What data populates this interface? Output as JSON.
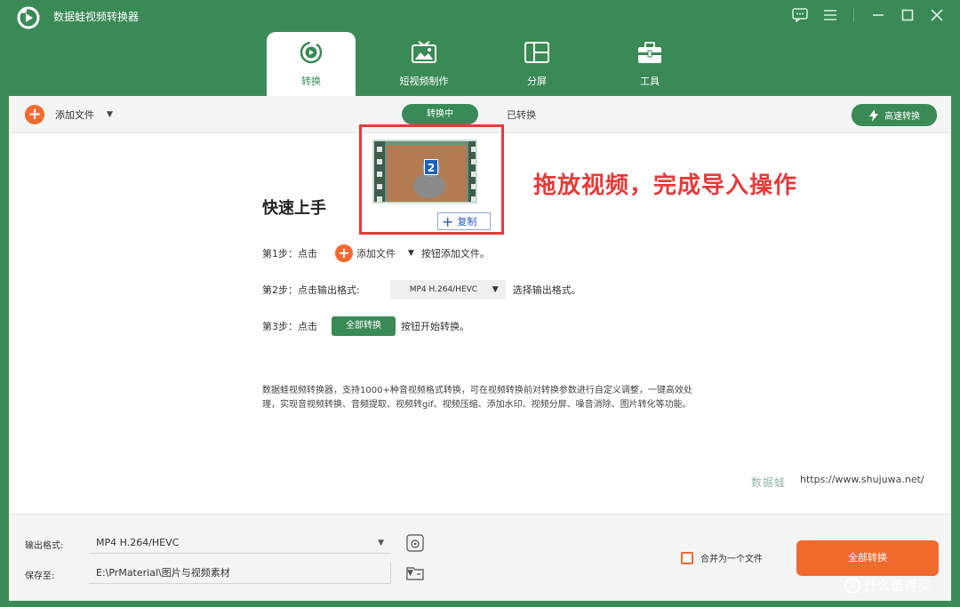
{
  "app": {
    "title": "数据蛙视频转换器"
  },
  "tabs": [
    {
      "label": "转换",
      "icon": "convert-icon",
      "active": true
    },
    {
      "label": "短视频制作",
      "icon": "short-video-icon",
      "active": false
    },
    {
      "label": "分屏",
      "icon": "split-screen-icon",
      "active": false
    },
    {
      "label": "工具",
      "icon": "toolbox-icon",
      "active": false
    }
  ],
  "toolbar": {
    "add_file_label": "添加文件",
    "seg_converting": "转换中",
    "seg_converted": "已转换",
    "speed_label": "高速转换"
  },
  "drag": {
    "badge": "2",
    "copy_label": "复制",
    "annotation": "拖放视频，完成导入操作"
  },
  "quick": {
    "title": "快速上手",
    "step1_prefix": "第1步：点击",
    "step1_button": "添加文件",
    "step1_suffix": "按钮添加文件。",
    "step2_prefix": "第2步：点击输出格式:",
    "step2_select": "MP4 H.264/HEVC",
    "step2_suffix": "选择输出格式。",
    "step3_prefix": "第3步：点击",
    "step3_button": "全部转换",
    "step3_suffix": "按钮开始转换。",
    "description": "数据蛙视频转换器，支持1000+种音视频格式转换，可在视频转换前对转换参数进行自定义调整，一键高效处理，实现音视频转换、音频提取、视频转gif、视频压缩、添加水印、视频分屏、噪音消除、图片转化等功能。"
  },
  "brand": {
    "watermark": "数据蛙",
    "url": "https://www.shujuwa.net/"
  },
  "bottom": {
    "output_label": "输出格式:",
    "output_value": "MP4 H.264/HEVC",
    "save_label": "保存至:",
    "save_value": "E:\\PrMaterial\\图片与视频素材",
    "merge_label": "合并为一个文件",
    "convert_all": "全部转换"
  },
  "corner_watermark": "什么值得买",
  "colors": {
    "primary": "#3a8a55",
    "accent": "#f06a2e",
    "annotation": "#e53a3a",
    "badge": "#1e5fbf"
  }
}
